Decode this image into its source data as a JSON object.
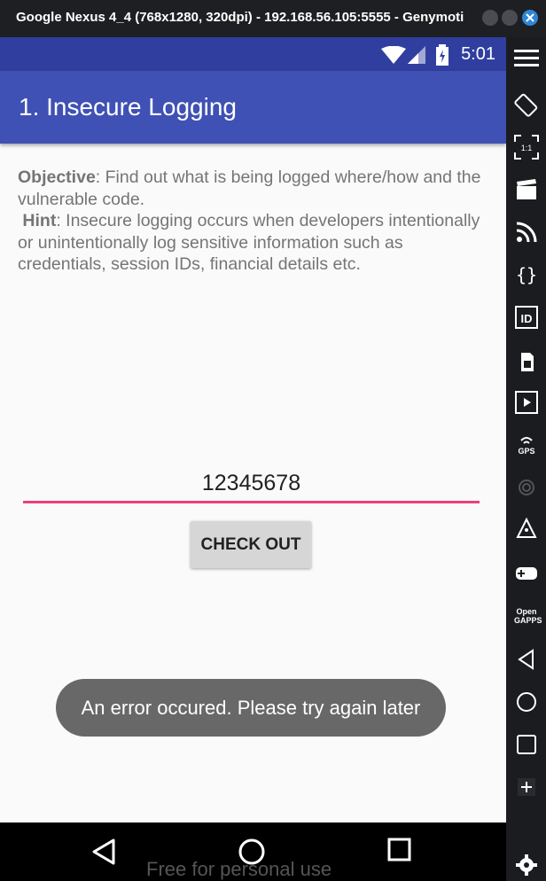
{
  "window": {
    "title": "Google Nexus 4_4 (768x1280, 320dpi) - 192.168.56.105:5555 - Genymoti…"
  },
  "status_bar": {
    "time": "5:01"
  },
  "app_bar": {
    "title": "1. Insecure Logging"
  },
  "content": {
    "objective_label": "Objective",
    "objective_text": ": Find out what is being logged where/how and the vulnerable code.",
    "hint_label": "Hint",
    "hint_text": ": Insecure logging occurs when developers intentionally or unintentionally log sensitive information such as credentials, session IDs, financial details etc.",
    "amount_value": "12345678",
    "checkout_label": "CHECK OUT"
  },
  "toast": {
    "message": "An error occured. Please try again later"
  },
  "watermark": "Free for personal use",
  "toolbar": {
    "pixel_ratio_label": "1:1",
    "gps_label": "GPS",
    "opengapps_label": "Open GAPPS",
    "id_label": "ID",
    "icons": [
      "menu-icon",
      "rotate-icon",
      "pixel-perfect-icon",
      "screencast-icon",
      "rss-icon",
      "javascript-icon",
      "device-id-icon",
      "sim-icon",
      "video-icon",
      "gps-icon",
      "fingerprint-icon",
      "network-icon",
      "gamepad-icon",
      "opengapps-icon",
      "back-icon",
      "home-icon",
      "recents-icon",
      "add-icon",
      "settings-icon"
    ]
  },
  "colors": {
    "primary": "#3f51b5",
    "primary_dark": "#303f9f",
    "accent": "#ec407a",
    "toast": "#686868"
  }
}
